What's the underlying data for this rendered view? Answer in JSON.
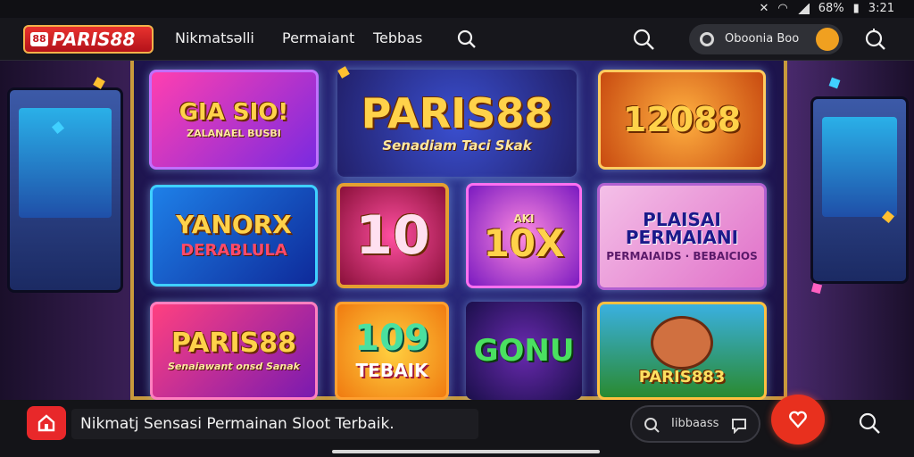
{
  "status_bar": {
    "battery": "68%",
    "time": "3:21"
  },
  "header": {
    "logo_text": "PARIS88",
    "logo_mark": "88",
    "nav": [
      "Nikmatsəlli",
      "Permaiant",
      "Tebbas"
    ],
    "account_pill": "Oboonia Boo",
    "icons": [
      "search-icon",
      "search-icon",
      "profile-icon",
      "search-icon"
    ]
  },
  "banner": {
    "tiles": [
      {
        "big": "GIA SIO!",
        "small": "ZALANAEL BUSBI"
      },
      {
        "big": "PARIS88",
        "small": "Senadiam Taci Skak"
      },
      {
        "big": "12088",
        "small": ""
      },
      {
        "big": "YANORX",
        "small": "DERABLULA"
      },
      {
        "big": "10",
        "small": ""
      },
      {
        "big": "10X",
        "small": "AKI"
      },
      {
        "big": "PLAISAI PERMAIANI",
        "small": "PERMAIAIDS · BEBAICIOS"
      },
      {
        "big": "PARIS88",
        "small": "Senaiawant onsd Sanak"
      },
      {
        "big": "109",
        "small": "TEBAIK"
      },
      {
        "big": "GONU",
        "small": ""
      },
      {
        "big": "PARIS883",
        "small": ""
      }
    ]
  },
  "bottom_bar": {
    "ticker_text": "Nikmatj Sensasi Permainan Sloot Terbaik.",
    "pill_label": "Iibbaass",
    "icons": [
      "home-icon",
      "gamepad-icon",
      "chat-icon",
      "heart-icon",
      "search-icon"
    ]
  },
  "colors": {
    "brand_red": "#e8282a",
    "gold": "#ffd24a",
    "dark": "#141418"
  }
}
